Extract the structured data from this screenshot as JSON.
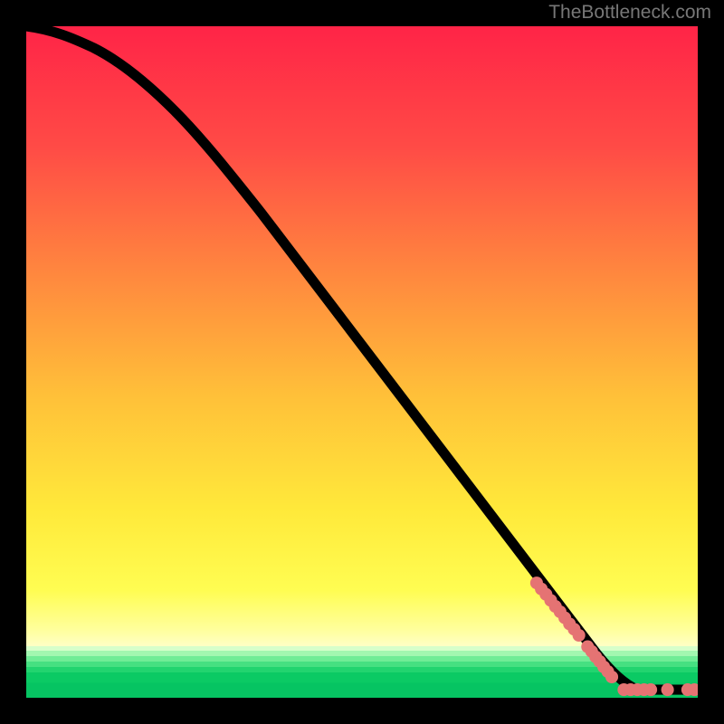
{
  "attribution": "TheBottleneck.com",
  "colors": {
    "black": "#000000",
    "marker": "#e57373",
    "gradient_top": "#ff2f4a",
    "gradient_mid_orange": "#ff9a3a",
    "gradient_yellow": "#ffe93a",
    "gradient_pale_yellow": "#ffff9c",
    "green_light": "#8affb0",
    "green_mid": "#3ddb7a",
    "green_dark": "#06c462"
  },
  "chart_data": {
    "type": "line",
    "title": "",
    "xlabel": "",
    "ylabel": "",
    "xlim": [
      0,
      100
    ],
    "ylim": [
      0,
      100
    ],
    "series": [
      {
        "name": "curve",
        "x": [
          0,
          5,
          10,
          15,
          20,
          25,
          30,
          35,
          40,
          45,
          50,
          55,
          60,
          65,
          70,
          75,
          80,
          85,
          90,
          95,
          100
        ],
        "y": [
          100,
          99.3,
          96.8,
          92.5,
          87.0,
          80.8,
          74.5,
          68.2,
          61.9,
          55.6,
          49.3,
          43.0,
          36.7,
          30.4,
          24.1,
          17.8,
          11.5,
          5.9,
          2.0,
          1.0,
          1.0
        ]
      },
      {
        "name": "markers-on-slope",
        "x": [
          76.0,
          76.7,
          77.4,
          78.1,
          78.8,
          79.5,
          80.2,
          80.9,
          81.6,
          82.3,
          83.6,
          84.2,
          84.8,
          85.4,
          86.0,
          86.6,
          87.2
        ],
        "y": [
          17.1,
          16.2,
          15.4,
          14.5,
          13.6,
          12.8,
          11.9,
          11.0,
          10.2,
          9.3,
          7.6,
          6.9,
          6.1,
          5.4,
          4.6,
          3.9,
          3.1
        ]
      },
      {
        "name": "markers-bottom",
        "x": [
          89.0,
          90.0,
          91.0,
          92.0,
          93.0,
          95.5,
          98.5,
          99.5
        ],
        "y": [
          1.2,
          1.2,
          1.2,
          1.2,
          1.2,
          1.2,
          1.2,
          1.2
        ]
      }
    ]
  }
}
